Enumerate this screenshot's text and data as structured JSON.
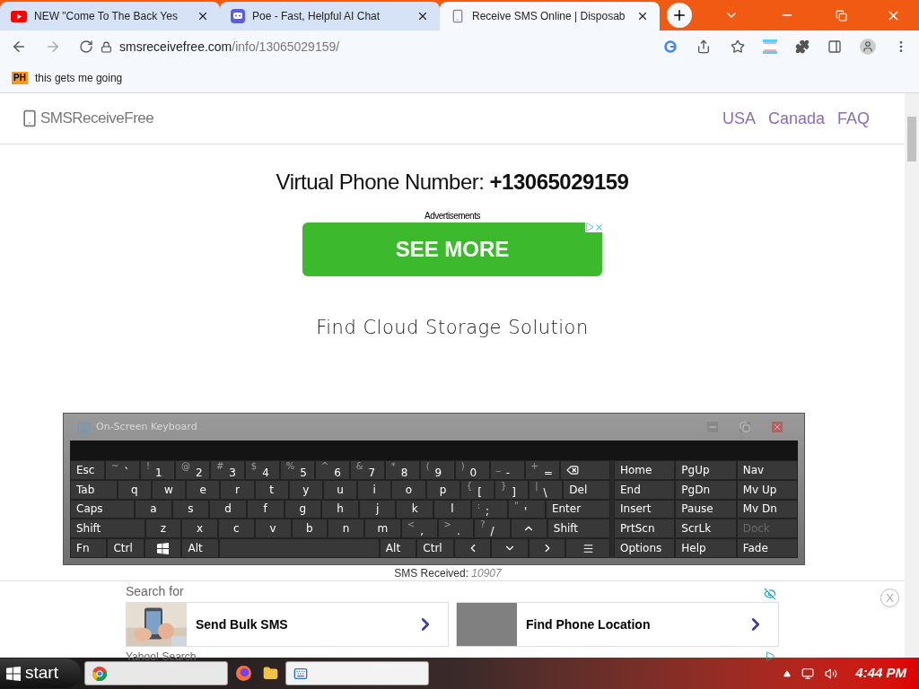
{
  "browser": {
    "tabs": [
      {
        "title": "NEW \"Come To The Back Yes",
        "kind": "youtube",
        "selected": false
      },
      {
        "title": "Poe - Fast, Helpful AI Chat",
        "kind": "poe",
        "selected": false
      },
      {
        "title": "Receive SMS Online | Disposab",
        "kind": "sms",
        "selected": true
      }
    ],
    "url_domain": "smsreceivefree.com",
    "url_path": "/info/13065029159/",
    "bookmarks": [
      {
        "badge": "PH",
        "label": "this gets me going"
      }
    ]
  },
  "page": {
    "logo": "SMSReceiveFree",
    "nav": [
      "USA",
      "Canada",
      "FAQ"
    ],
    "heading": "Virtual Phone Number: **+13065029159**",
    "ad_label": "Advertisements",
    "ad_button": "SEE MORE",
    "subheading": "Find Cloud Storage Solution",
    "sms_received_label": "SMS Received:",
    "sms_received_count": "10907"
  },
  "keyboard": {
    "title": "On-Screen Keyboard",
    "main_rows": [
      [
        {
          "label": "Esc",
          "kind": "key"
        },
        {
          "shift": "~",
          "label": "`",
          "kind": "key"
        },
        {
          "shift": "!",
          "label": "1",
          "kind": "key"
        },
        {
          "shift": "@",
          "label": "2",
          "kind": "key"
        },
        {
          "shift": "#",
          "label": "3",
          "kind": "key"
        },
        {
          "shift": "$",
          "label": "4",
          "kind": "key"
        },
        {
          "shift": "%",
          "label": "5",
          "kind": "key"
        },
        {
          "shift": "^",
          "label": "6",
          "kind": "key"
        },
        {
          "shift": "&",
          "label": "7",
          "kind": "key"
        },
        {
          "shift": "*",
          "label": "8",
          "kind": "key"
        },
        {
          "shift": "(",
          "label": "9",
          "kind": "key"
        },
        {
          "shift": ")",
          "label": "0",
          "kind": "key"
        },
        {
          "shift": "_",
          "label": "-",
          "kind": "key"
        },
        {
          "shift": "+",
          "label": "=",
          "kind": "key"
        },
        {
          "kind": "backspace"
        }
      ],
      [
        {
          "label": "Tab",
          "kind": "wide"
        },
        {
          "label": "q",
          "kind": "key"
        },
        {
          "label": "w",
          "kind": "key"
        },
        {
          "label": "e",
          "kind": "key"
        },
        {
          "label": "r",
          "kind": "key"
        },
        {
          "label": "t",
          "kind": "key"
        },
        {
          "label": "y",
          "kind": "key"
        },
        {
          "label": "u",
          "kind": "key"
        },
        {
          "label": "i",
          "kind": "key"
        },
        {
          "label": "o",
          "kind": "key"
        },
        {
          "label": "p",
          "kind": "key"
        },
        {
          "shift": "{",
          "label": "[",
          "kind": "key"
        },
        {
          "shift": "}",
          "label": "]",
          "kind": "key"
        },
        {
          "shift": "|",
          "label": "\\",
          "kind": "key"
        },
        {
          "label": "Del",
          "kind": "wide"
        }
      ],
      [
        {
          "label": "Caps",
          "kind": "wider"
        },
        {
          "label": "a",
          "kind": "key"
        },
        {
          "label": "s",
          "kind": "key"
        },
        {
          "label": "d",
          "kind": "key"
        },
        {
          "label": "f",
          "kind": "key"
        },
        {
          "label": "g",
          "kind": "key"
        },
        {
          "label": "h",
          "kind": "key"
        },
        {
          "label": "j",
          "kind": "key"
        },
        {
          "label": "k",
          "kind": "key"
        },
        {
          "label": "l",
          "kind": "key"
        },
        {
          "shift": ":",
          "label": ";",
          "kind": "key"
        },
        {
          "shift": "\"",
          "label": "'",
          "kind": "key"
        },
        {
          "label": "Enter",
          "kind": "wider"
        }
      ],
      [
        {
          "label": "Shift",
          "kind": "widest"
        },
        {
          "label": "z",
          "kind": "key"
        },
        {
          "label": "x",
          "kind": "key"
        },
        {
          "label": "c",
          "kind": "key"
        },
        {
          "label": "v",
          "kind": "key"
        },
        {
          "label": "b",
          "kind": "key"
        },
        {
          "label": "n",
          "kind": "key"
        },
        {
          "label": "m",
          "kind": "key"
        },
        {
          "shift": "<",
          "label": ",",
          "kind": "key"
        },
        {
          "shift": ">",
          "label": ".",
          "kind": "key"
        },
        {
          "shift": "?",
          "label": "/",
          "kind": "key"
        },
        {
          "kind": "up"
        },
        {
          "label": "Shift",
          "kind": "wider"
        }
      ],
      [
        {
          "label": "Fn",
          "kind": "key"
        },
        {
          "label": "Ctrl",
          "kind": "key"
        },
        {
          "kind": "windows"
        },
        {
          "label": "Alt",
          "kind": "key"
        },
        {
          "kind": "space"
        },
        {
          "label": "Alt",
          "kind": "key"
        },
        {
          "label": "Ctrl",
          "kind": "key"
        },
        {
          "kind": "left"
        },
        {
          "kind": "down"
        },
        {
          "kind": "right"
        },
        {
          "kind": "menu"
        }
      ]
    ],
    "side_rows": [
      [
        {
          "label": "Home",
          "disabled": false
        },
        {
          "label": "PgUp",
          "disabled": false
        },
        {
          "label": "Nav",
          "disabled": false
        }
      ],
      [
        {
          "label": "End",
          "disabled": false
        },
        {
          "label": "PgDn",
          "disabled": false
        },
        {
          "label": "Mv Up",
          "disabled": false
        }
      ],
      [
        {
          "label": "Insert",
          "disabled": false
        },
        {
          "label": "Pause",
          "disabled": false
        },
        {
          "label": "Mv Dn",
          "disabled": false
        }
      ],
      [
        {
          "label": "PrtScn",
          "disabled": false
        },
        {
          "label": "ScrLk",
          "disabled": false
        },
        {
          "label": "Dock",
          "disabled": true
        }
      ],
      [
        {
          "label": "Options",
          "disabled": false
        },
        {
          "label": "Help",
          "disabled": false
        },
        {
          "label": "Fade",
          "disabled": false
        }
      ]
    ]
  },
  "bottom_ad": {
    "title": "Search for",
    "items": [
      {
        "label": "Send Bulk SMS"
      },
      {
        "label": "Find Phone Location",
        "kind": "blank"
      }
    ],
    "footer": "Yahoo! Search",
    "close": "X"
  },
  "taskbar": {
    "start": "start",
    "items": [
      {
        "kind": "chrome"
      },
      {
        "kind": "firefox"
      },
      {
        "kind": "folder"
      },
      {
        "kind": "keyboard"
      }
    ],
    "time": "4:44 PM"
  }
}
